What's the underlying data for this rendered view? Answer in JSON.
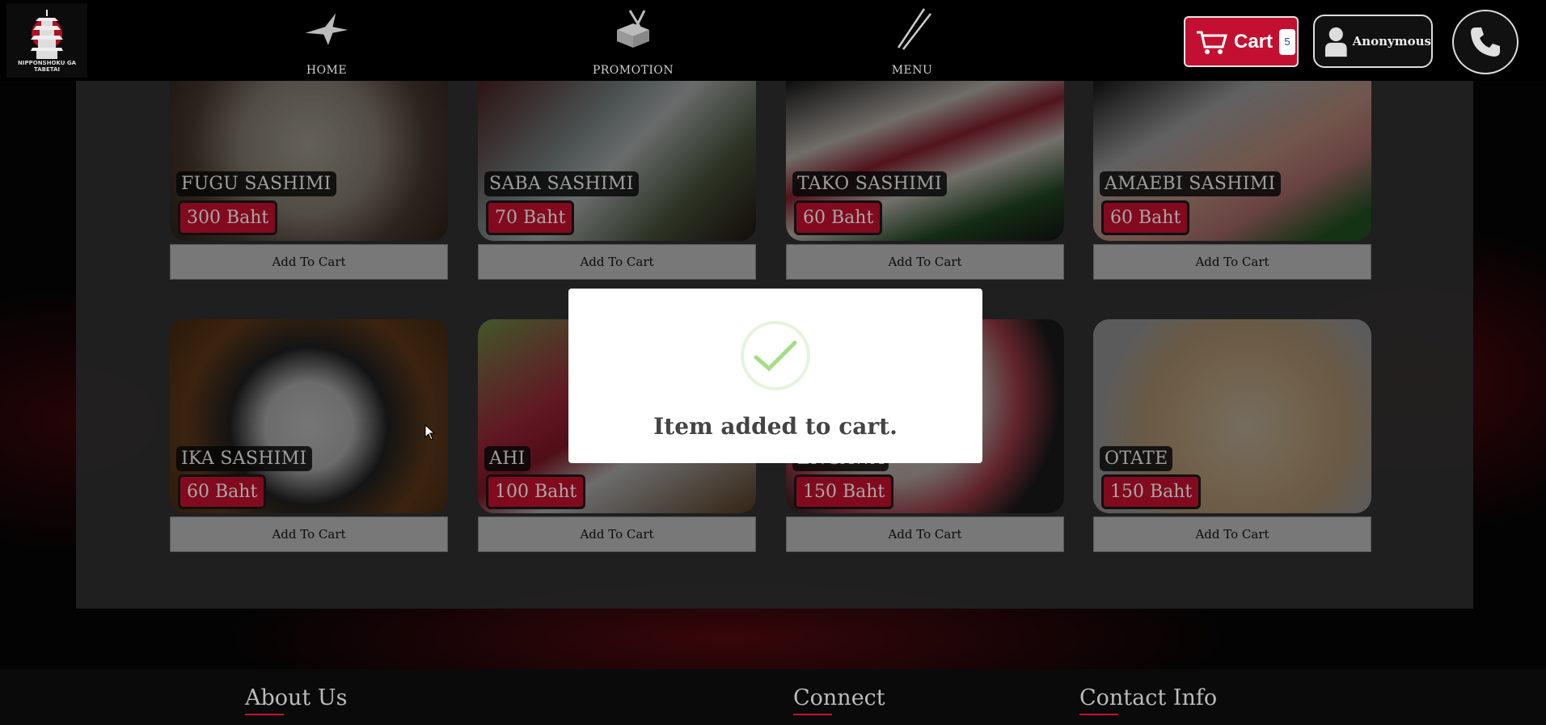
{
  "logo": {
    "text": "NIPPONSHOKU GA TABETAI",
    "icon": "pagoda-icon"
  },
  "nav": [
    {
      "label": "HOME",
      "icon": "crane-icon"
    },
    {
      "label": "PROMOTION",
      "icon": "bento-box-icon"
    },
    {
      "label": "MENU",
      "icon": "chopsticks-icon"
    }
  ],
  "cart": {
    "label": "Cart",
    "count": "5",
    "color": "#c41030"
  },
  "user": {
    "label": "Anonymous"
  },
  "products": [
    {
      "name": "FUGU SASHIMI",
      "price": "300 Baht",
      "button": "Add To Cart"
    },
    {
      "name": "SABA SASHIMI",
      "price": "70 Baht",
      "button": "Add To Cart"
    },
    {
      "name": "TAKO SASHIMI",
      "price": "60 Baht",
      "button": "Add To Cart"
    },
    {
      "name": "AMAEBI SASHIMI",
      "price": "60 Baht",
      "button": "Add To Cart"
    },
    {
      "name": "IKA SASHIMI",
      "price": "60 Baht",
      "button": "Add To Cart"
    },
    {
      "name": "AHI",
      "price": "100 Baht",
      "button": "Add To Cart"
    },
    {
      "name": "ENGAWA",
      "price": "150 Baht",
      "button": "Add To Cart"
    },
    {
      "name": "OTATE",
      "price": "150 Baht",
      "button": "Add To Cart"
    }
  ],
  "modal": {
    "title": "Item added to cart.",
    "icon": "checkmark-icon"
  },
  "footer": {
    "about": "About Us",
    "connect": "Connect",
    "contact": "Contact Info"
  }
}
